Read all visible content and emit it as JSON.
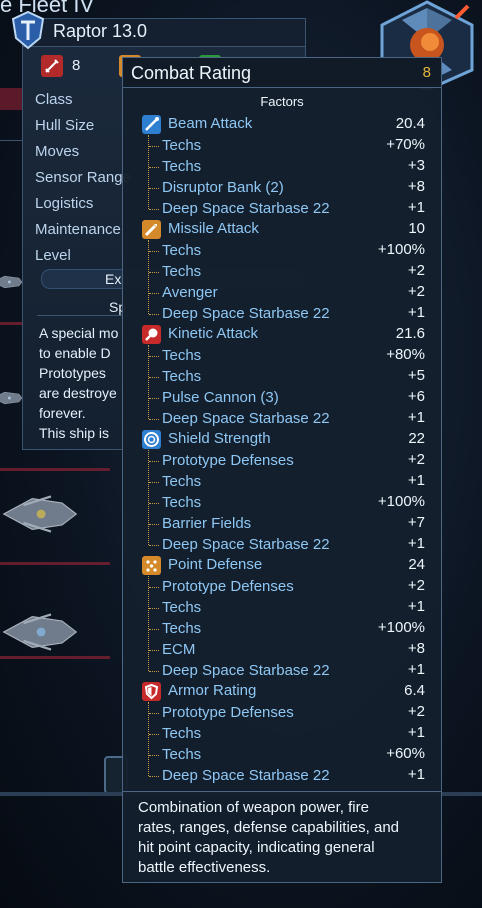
{
  "background": {
    "fleet_title": "e Fleet IV"
  },
  "ship_panel": {
    "name": "Raptor 13.0",
    "stats": [
      {
        "icon": "sword-icon",
        "value": "8",
        "color": "#b22a2a"
      },
      {
        "icon": "shield-orange-icon",
        "value": "",
        "color": "#d48a2a"
      },
      {
        "icon": "green-icon",
        "value": "",
        "color": "#2a9a3a"
      }
    ],
    "properties": [
      "Class",
      "Hull Size",
      "Moves",
      "Sensor Range",
      "Logistics",
      "Maintenance",
      "Level"
    ],
    "exp_label": "Ex",
    "special_title": "Sp",
    "description_lines": [
      "A special mo",
      "to enable D",
      "Prototypes",
      "are destroye",
      "forever.",
      "This ship is"
    ]
  },
  "tooltip": {
    "title": "Combat Rating",
    "value": "8",
    "factors_heading": "Factors",
    "categories": [
      {
        "name": "Beam Attack",
        "value": "20.4",
        "icon": "beam-icon",
        "color": "#2f7fd0",
        "items": [
          {
            "label": "Techs",
            "value": "+70%"
          },
          {
            "label": "Techs",
            "value": "+3"
          },
          {
            "label": "Disruptor Bank (2)",
            "value": "+8"
          },
          {
            "label": "Deep Space Starbase 22",
            "value": "+1"
          }
        ]
      },
      {
        "name": "Missile Attack",
        "value": "10",
        "icon": "missile-icon",
        "color": "#d48a2a",
        "items": [
          {
            "label": "Techs",
            "value": "+100%"
          },
          {
            "label": "Techs",
            "value": "+2"
          },
          {
            "label": "Avenger",
            "value": "+2"
          },
          {
            "label": "Deep Space Starbase 22",
            "value": "+1"
          }
        ]
      },
      {
        "name": "Kinetic Attack",
        "value": "21.6",
        "icon": "kinetic-icon",
        "color": "#c62a2a",
        "items": [
          {
            "label": "Techs",
            "value": "+80%"
          },
          {
            "label": "Techs",
            "value": "+5"
          },
          {
            "label": "Pulse Cannon (3)",
            "value": "+6"
          },
          {
            "label": "Deep Space Starbase 22",
            "value": "+1"
          }
        ]
      },
      {
        "name": "Shield Strength",
        "value": "22",
        "icon": "shield-strength-icon",
        "color": "#2f7fd0",
        "items": [
          {
            "label": "Prototype Defenses",
            "value": "+2"
          },
          {
            "label": "Techs",
            "value": "+1"
          },
          {
            "label": "Techs",
            "value": "+100%"
          },
          {
            "label": "Barrier Fields",
            "value": "+7"
          },
          {
            "label": "Deep Space Starbase 22",
            "value": "+1"
          }
        ]
      },
      {
        "name": "Point Defense",
        "value": "24",
        "icon": "point-defense-icon",
        "color": "#d48a2a",
        "items": [
          {
            "label": "Prototype Defenses",
            "value": "+2"
          },
          {
            "label": "Techs",
            "value": "+1"
          },
          {
            "label": "Techs",
            "value": "+100%"
          },
          {
            "label": "ECM",
            "value": "+8"
          },
          {
            "label": "Deep Space Starbase 22",
            "value": "+1"
          }
        ]
      },
      {
        "name": "Armor Rating",
        "value": "6.4",
        "icon": "armor-icon",
        "color": "#c62a2a",
        "items": [
          {
            "label": "Prototype Defenses",
            "value": "+2"
          },
          {
            "label": "Techs",
            "value": "+1"
          },
          {
            "label": "Techs",
            "value": "+60%"
          },
          {
            "label": "Deep Space Starbase 22",
            "value": "+1"
          }
        ]
      }
    ],
    "description_lines": [
      "Combination of weapon power, fire",
      "rates, ranges, defense capabilities, and",
      "hit point capacity, indicating general",
      "battle effectiveness."
    ]
  }
}
